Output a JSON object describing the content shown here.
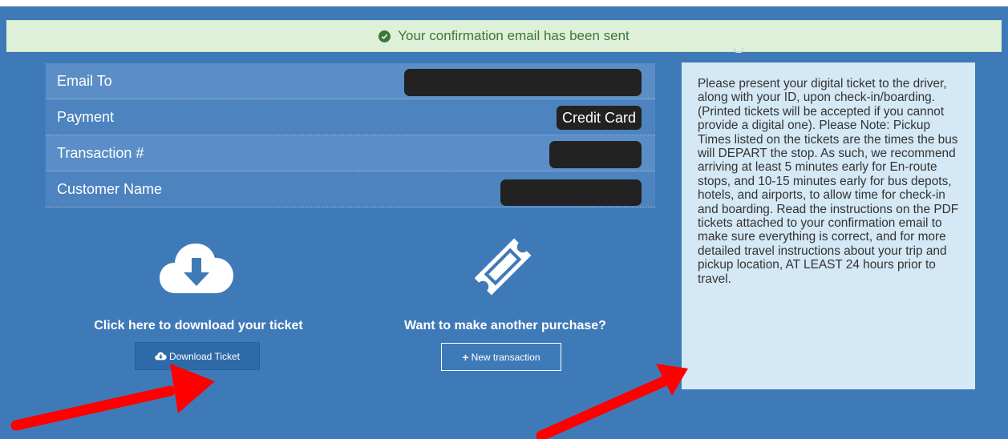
{
  "alert": {
    "icon": "check-circle-icon",
    "message": "Your confirmation email has been sent"
  },
  "details": {
    "rows": [
      {
        "label": "Email To",
        "value": "",
        "redacted": true
      },
      {
        "label": "Payment",
        "value": "Credit Card",
        "redacted": false
      },
      {
        "label": "Transaction #",
        "value": "",
        "redacted": true
      },
      {
        "label": "Customer Name",
        "value": "",
        "redacted": true
      }
    ]
  },
  "download": {
    "icon": "cloud-download-icon",
    "heading": "Click here to download your ticket",
    "button_label": "Download Ticket",
    "button_icon": "cloud-download-icon"
  },
  "new_purchase": {
    "icon": "ticket-icon",
    "heading": "Want to make another purchase?",
    "button_label": "New transaction",
    "button_icon": "plus-icon"
  },
  "instructions": {
    "text": "Please present your digital ticket to the driver, along with your ID, upon check-in/boarding. (Printed tickets will be accepted if you cannot provide a digital one). Please Note: Pickup Times listed on the tickets are the times the bus will DEPART the stop. As such, we recommend arriving at least 5 minutes early for En-route stops, and 10-15 minutes early for bus depots, hotels, and airports, to allow time for check-in and boarding. Read the instructions on the PDF tickets attached to your confirmation email to make sure everything is correct, and for more detailed travel instructions about your trip and pickup location, AT LEAST 24 hours prior to travel."
  },
  "annotations": {
    "arrow_color": "#ff0000",
    "count": 2
  },
  "colors": {
    "background": "#3f7ab8",
    "alert_bg": "#dff0d8",
    "alert_text": "#3c763d",
    "info_bg": "#d5e8f5"
  }
}
